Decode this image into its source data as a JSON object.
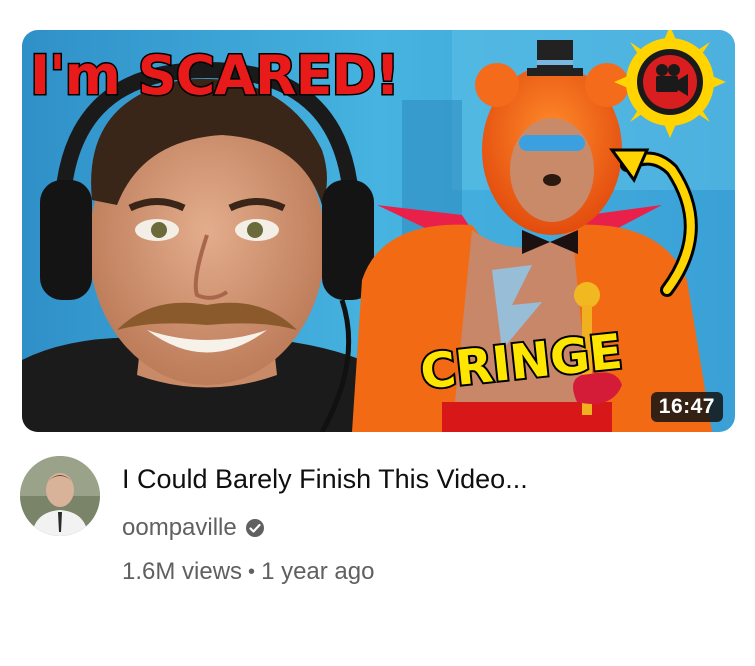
{
  "video": {
    "thumbnail": {
      "headline_text": "I'm SCARED!",
      "overlay_text": "CRINGE",
      "badge_icon": "video-camera-icon",
      "arrow_icon": "curved-arrow-icon",
      "colors": {
        "headline_red": "#e81a1a",
        "overlay_yellow": "#ffe600",
        "background_blue": "#3aa5d8",
        "badge_sun": "#ffd400"
      }
    },
    "duration": "16:47",
    "title": "I Could Barely Finish This Video...",
    "channel": {
      "name": "oompaville",
      "verified_icon": "verified-check-icon"
    },
    "views": "1.6M views",
    "separator": "•",
    "age": "1 year ago"
  }
}
